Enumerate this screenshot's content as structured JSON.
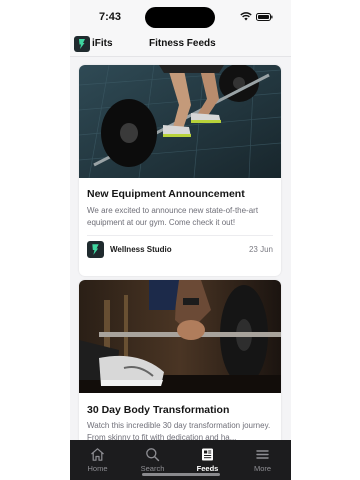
{
  "status_bar": {
    "time": "7:43"
  },
  "header": {
    "brand": "iFits",
    "title": "Fitness Feeds",
    "logo_icon": "ifits-logo-icon"
  },
  "feed": {
    "posts": [
      {
        "title": "New Equipment Announcement",
        "description": "We are excited to announce new state-of-the-art equipment at our gym. Come check it out!",
        "author": "Wellness Studio",
        "date": "23 Jun",
        "image": "deadlift-barbell-photo"
      },
      {
        "title": "30 Day Body Transformation",
        "description": "Watch this incredible 30 day transformation journey. From skinny to fit with dedication and ha...",
        "image": "barbell-grip-photo"
      }
    ]
  },
  "tab_bar": {
    "active": "Feeds",
    "tabs": [
      {
        "label": "Home",
        "icon": "home-icon"
      },
      {
        "label": "Search",
        "icon": "search-icon"
      },
      {
        "label": "Feeds",
        "icon": "feeds-icon"
      },
      {
        "label": "More",
        "icon": "menu-icon"
      }
    ]
  },
  "colors": {
    "tab_bar_bg": "#1c1c1e",
    "active_tab": "#ffffff",
    "inactive_tab": "#8e8e93",
    "logo_bg": "#1f2a2e"
  }
}
